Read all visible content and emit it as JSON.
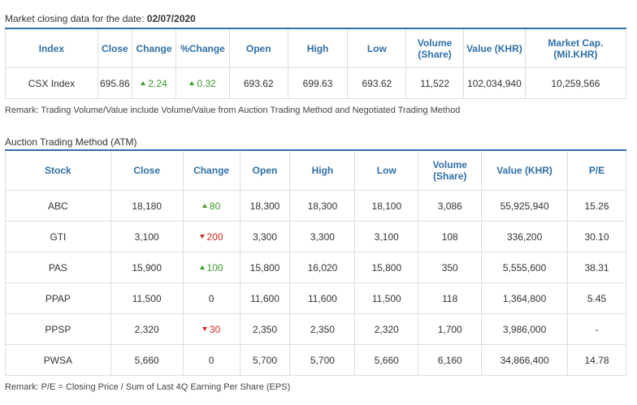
{
  "market": {
    "caption_prefix": "Market closing data for the date:",
    "date": "02/07/2020",
    "headers": {
      "index": "Index",
      "close": "Close",
      "change": "Change",
      "pct_change": "%Change",
      "open": "Open",
      "high": "High",
      "low": "Low",
      "volume_1": "Volume",
      "volume_2": "(Share)",
      "value": "Value (KHR)",
      "mcap_1": "Market Cap.",
      "mcap_2": "(Mil.KHR)"
    },
    "row": {
      "index": "CSX Index",
      "close": "695.86",
      "change": "2.24",
      "change_dir": "up",
      "pct_change": "0.32",
      "pct_change_dir": "up",
      "open": "693.62",
      "high": "699.63",
      "low": "693.62",
      "volume": "11,522",
      "value": "102,034,940",
      "mcap": "10,259,566"
    },
    "remark": "Remark: Trading Volume/Value include Volume/Value from Auction Trading Method and Negotiated Trading Method"
  },
  "auction": {
    "caption": "Auction Trading Method (ATM)",
    "headers": {
      "stock": "Stock",
      "close": "Close",
      "change": "Change",
      "open": "Open",
      "high": "High",
      "low": "Low",
      "volume_1": "Volume",
      "volume_2": "(Share)",
      "value": "Value (KHR)",
      "pe": "P/E"
    },
    "rows": [
      {
        "stock": "ABC",
        "close": "18,180",
        "change": "80",
        "change_dir": "up",
        "open": "18,300",
        "high": "18,300",
        "low": "18,100",
        "volume": "3,086",
        "value": "55,925,940",
        "pe": "15.26"
      },
      {
        "stock": "GTI",
        "close": "3,100",
        "change": "200",
        "change_dir": "down",
        "open": "3,300",
        "high": "3,300",
        "low": "3,100",
        "volume": "108",
        "value": "336,200",
        "pe": "30.10"
      },
      {
        "stock": "PAS",
        "close": "15,900",
        "change": "100",
        "change_dir": "up",
        "open": "15,800",
        "high": "16,020",
        "low": "15,800",
        "volume": "350",
        "value": "5,555,600",
        "pe": "38.31"
      },
      {
        "stock": "PPAP",
        "close": "11,500",
        "change": "0",
        "change_dir": "none",
        "open": "11,600",
        "high": "11,600",
        "low": "11,500",
        "volume": "118",
        "value": "1,364,800",
        "pe": "5.45"
      },
      {
        "stock": "PPSP",
        "close": "2,320",
        "change": "30",
        "change_dir": "down",
        "open": "2,350",
        "high": "2,350",
        "low": "2,320",
        "volume": "1,700",
        "value": "3,986,000",
        "pe": "-"
      },
      {
        "stock": "PWSA",
        "close": "5,660",
        "change": "0",
        "change_dir": "none",
        "open": "5,700",
        "high": "5,700",
        "low": "5,660",
        "volume": "6,160",
        "value": "34,866,400",
        "pe": "14.78"
      }
    ],
    "remark": "Remark: P/E = Closing Price / Sum of Last 4Q Earning Per Share (EPS)"
  },
  "colors": {
    "header_text": "#2f6fa7",
    "up": "#3a9a2b",
    "down": "#d0281d",
    "border": "#dddddd"
  },
  "icons": {
    "up": "triangle-up-icon",
    "down": "triangle-down-icon"
  }
}
